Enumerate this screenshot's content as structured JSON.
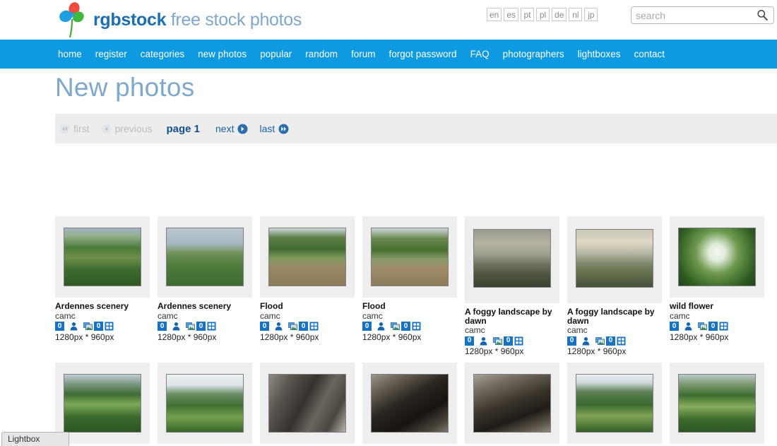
{
  "site": {
    "logo_bold": "rgbstock",
    "logo_light": " free stock photos",
    "colors": {
      "nav_blue": "#0d9ae0",
      "brand_blue": "#1a6fb5",
      "brand_light_blue": "#7ea8cc",
      "badge_blue": "#1673c4",
      "panel_gray": "#ededed",
      "thumb_box_gray": "#eeeeee"
    }
  },
  "languages": [
    {
      "code": "en",
      "name": "language-en"
    },
    {
      "code": "es",
      "name": "language-es"
    },
    {
      "code": "pt",
      "name": "language-pt"
    },
    {
      "code": "pl",
      "name": "language-pl"
    },
    {
      "code": "de",
      "name": "language-de"
    },
    {
      "code": "nl",
      "name": "language-nl"
    },
    {
      "code": "jp",
      "name": "language-jp"
    }
  ],
  "search": {
    "value": "",
    "placeholder": "search",
    "icon": "search-icon"
  },
  "nav": [
    "home",
    "register",
    "categories",
    "new photos",
    "popular",
    "random",
    "forum",
    "forgot password",
    "FAQ",
    "photographers",
    "lightboxes",
    "contact"
  ],
  "page": {
    "title": "New photos"
  },
  "pagination": {
    "first": "first",
    "previous": "previous",
    "current": "page 1",
    "next": "next",
    "last": "last",
    "first_icon": "double-arrow-left-icon",
    "previous_icon": "arrow-left-icon",
    "next_icon": "arrow-right-icon",
    "last_icon": "double-arrow-right-icon",
    "first_enabled": false,
    "previous_enabled": false,
    "next_enabled": true,
    "last_enabled": true
  },
  "photos": [
    {
      "title": "Ardennes scenery",
      "author": "camc",
      "comments": "0",
      "downloads": "0",
      "dimensions": "1280px * 960px",
      "thumb": "village-church-green-valley"
    },
    {
      "title": "Ardennes scenery",
      "author": "camc",
      "comments": "0",
      "downloads": "0",
      "dimensions": "1280px * 960px",
      "thumb": "green-hills-cloudy-sky"
    },
    {
      "title": "Flood",
      "author": "camc",
      "comments": "0",
      "downloads": "0",
      "dimensions": "1280px * 960px",
      "thumb": "flooded-river-trees"
    },
    {
      "title": "Flood",
      "author": "camc",
      "comments": "0",
      "downloads": "0",
      "dimensions": "1280px * 960px",
      "thumb": "flooded-river-houses"
    },
    {
      "title": "A foggy landscape by dawn",
      "author": "camc",
      "comments": "0",
      "downloads": "0",
      "dimensions": "1280px * 960px",
      "thumb": "foggy-river-dawn-dark"
    },
    {
      "title": "A foggy landscape by dawn",
      "author": "camc",
      "comments": "0",
      "downloads": "0",
      "dimensions": "1280px * 960px",
      "thumb": "foggy-river-dawn-light"
    },
    {
      "title": "wild flower",
      "author": "camc",
      "comments": "0",
      "downloads": "0",
      "dimensions": "1280px * 960px",
      "thumb": "white-wild-flower-green"
    }
  ],
  "photos_row2": [
    {
      "thumb": "river-bend-valley-overview"
    },
    {
      "thumb": "river-bend-valley-wide"
    },
    {
      "thumb": "dark-rock-wall-texture"
    },
    {
      "thumb": "cave-entrance-dark"
    },
    {
      "thumb": "cave-rock-interior"
    },
    {
      "thumb": "village-river-valley-aerial"
    },
    {
      "thumb": "green-valley-farmland"
    }
  ],
  "icons": {
    "comment_icon": "user-icon",
    "download_icon": "photo-stack-icon",
    "meta_icon": "grid-icon"
  },
  "lightbox": {
    "label": "Lightbox"
  }
}
